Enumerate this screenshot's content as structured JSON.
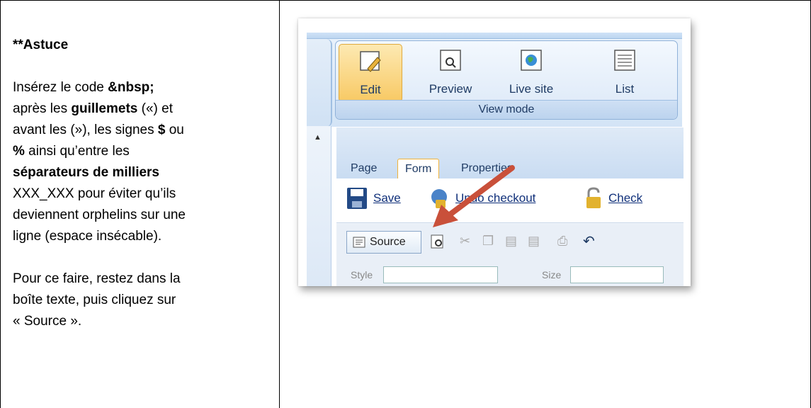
{
  "tip": {
    "title": "**Astuce",
    "p1_a": "Insérez le code ",
    "p1_code": "&nbsp;",
    "p1_b": "après les ",
    "p1_guillemets": "guillemets",
    "p1_c": " («) et",
    "p1_d": "avant les (»), les signes ",
    "p1_dollar": "$",
    "p1_e": " ou",
    "p1_percent": "%",
    "p1_f": " ainsi qu’entre les",
    "p1_sep": "séparateurs de milliers",
    "p1_g": "XXX_XXX pour éviter qu’ils",
    "p1_h": "deviennent orphelins sur une",
    "p1_i": "ligne (espace insécable).",
    "p2_a": "Pour ce faire, restez dans la",
    "p2_b": "boîte texte, puis cliquez sur",
    "p2_c": "« Source »."
  },
  "screenshot": {
    "ribbon": {
      "group_title": "View mode",
      "buttons": [
        "Edit",
        "Preview",
        "Live site",
        "List"
      ]
    },
    "tabs": [
      "Page",
      "Form",
      "Properties"
    ],
    "actions": [
      "Save",
      "Undo checkout",
      "Check"
    ],
    "source_button": "Source",
    "toolbar3": [
      "Style",
      "Size"
    ],
    "colors": {
      "arrow": "#c9503a",
      "active_tab_border": "#f0b23a",
      "ribbon_blue": "#d3e4f6"
    }
  }
}
